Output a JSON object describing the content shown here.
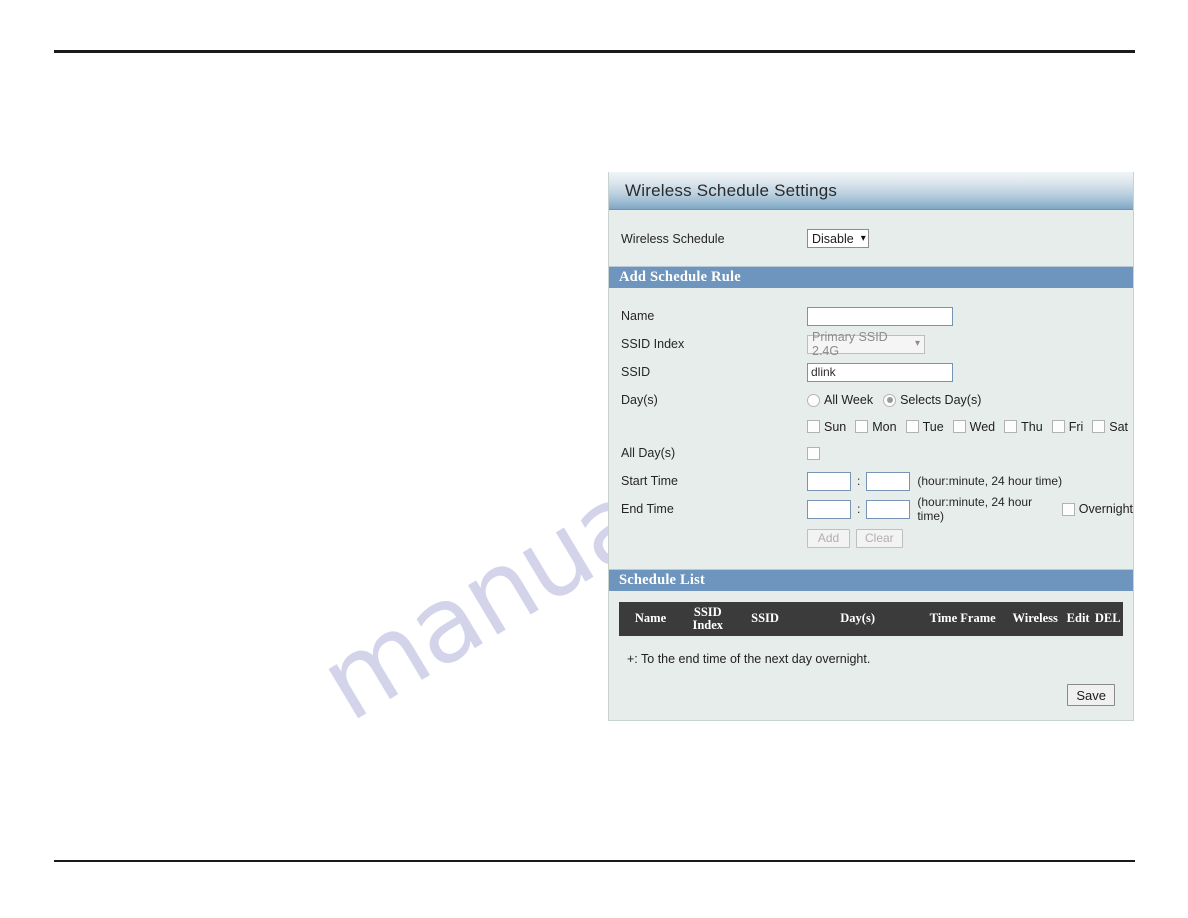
{
  "watermark": {
    "text": "manualshive.com"
  },
  "panel": {
    "title": "Wireless Schedule Settings",
    "wireless_schedule": {
      "label": "Wireless Schedule",
      "value": "Disable",
      "caret": "chevron-down-icon"
    },
    "add_rule": {
      "section_title": "Add Schedule Rule",
      "name": {
        "label": "Name",
        "value": "",
        "placeholder": ""
      },
      "ssid_index": {
        "label": "SSID Index",
        "value": "Primary SSID 2.4G",
        "disabled": true
      },
      "ssid": {
        "label": "SSID",
        "value": "dlink",
        "placeholder": ""
      },
      "days": {
        "label": "Day(s)",
        "radios": [
          {
            "label": "All Week",
            "checked": false
          },
          {
            "label": "Selects Day(s)",
            "checked": true
          }
        ],
        "checkboxes": [
          {
            "label": "Sun",
            "checked": false
          },
          {
            "label": "Mon",
            "checked": false
          },
          {
            "label": "Tue",
            "checked": false
          },
          {
            "label": "Wed",
            "checked": false
          },
          {
            "label": "Thu",
            "checked": false
          },
          {
            "label": "Fri",
            "checked": false
          },
          {
            "label": "Sat",
            "checked": false
          }
        ]
      },
      "all_days": {
        "label": "All Day(s)",
        "checked": false
      },
      "start_time": {
        "label": "Start Time",
        "hour": "",
        "minute": "",
        "separator": ":",
        "hint": "(hour:minute, 24 hour time)"
      },
      "end_time": {
        "label": "End Time",
        "hour": "",
        "minute": "",
        "separator": ":",
        "hint": "(hour:minute, 24 hour time)",
        "overnight": {
          "label": "Overnight",
          "checked": false
        }
      },
      "buttons": {
        "add": "Add",
        "clear": "Clear"
      }
    },
    "schedule_list": {
      "section_title": "Schedule List",
      "columns": [
        "Name",
        "SSID Index",
        "SSID",
        "Day(s)",
        "Time Frame",
        "Wireless",
        "Edit",
        "DEL"
      ],
      "rows": [],
      "note": "+: To the end time of the next day overnight."
    },
    "save_label": "Save"
  },
  "colors": {
    "section_bar": "#6e95bd",
    "table_head": "#3b3b3b",
    "panel_bg": "#e7edea",
    "field_border": "#7694b4"
  }
}
